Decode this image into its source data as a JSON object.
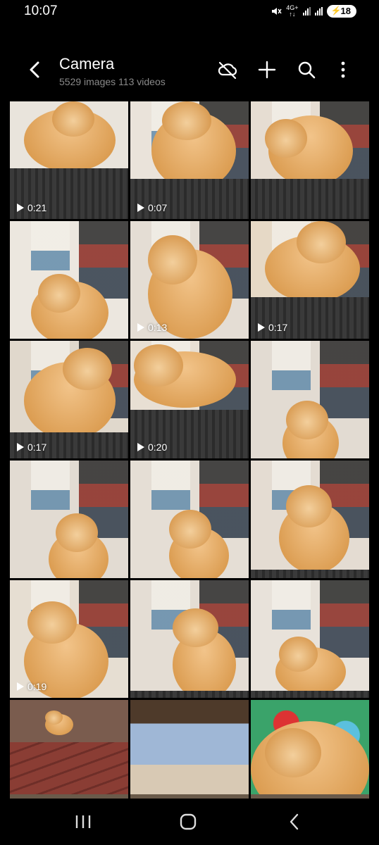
{
  "status_bar": {
    "time": "10:07",
    "network_label": "4G+",
    "battery_level": "18",
    "icons": [
      "mute-icon",
      "network-4g-icon",
      "signal-icon",
      "signal-icon",
      "battery-charging-icon"
    ]
  },
  "header": {
    "title": "Camera",
    "subtitle": "5529 images 113 videos",
    "icons": [
      "back-icon",
      "cloud-off-icon",
      "add-icon",
      "search-icon",
      "more-icon"
    ]
  },
  "grid": {
    "items": [
      {
        "type": "video",
        "duration": "0:21"
      },
      {
        "type": "video",
        "duration": "0:07"
      },
      {
        "type": "image",
        "duration": ""
      },
      {
        "type": "image",
        "duration": ""
      },
      {
        "type": "video",
        "duration": "0:13"
      },
      {
        "type": "video",
        "duration": "0:17"
      },
      {
        "type": "video",
        "duration": "0:17"
      },
      {
        "type": "video",
        "duration": "0:20"
      },
      {
        "type": "image",
        "duration": ""
      },
      {
        "type": "image",
        "duration": ""
      },
      {
        "type": "image",
        "duration": ""
      },
      {
        "type": "image",
        "duration": ""
      },
      {
        "type": "video",
        "duration": "0:19"
      },
      {
        "type": "image",
        "duration": ""
      },
      {
        "type": "image",
        "duration": ""
      },
      {
        "type": "image",
        "duration": ""
      },
      {
        "type": "image",
        "duration": ""
      },
      {
        "type": "image",
        "duration": ""
      }
    ]
  },
  "nav_bar": {
    "icons": [
      "recent-apps-icon",
      "home-icon",
      "back-nav-icon"
    ]
  },
  "colors": {
    "background": "#000000",
    "subtitle": "#8a8a8a",
    "cat": "#d99a4a",
    "wall": "#ddd6cc"
  }
}
